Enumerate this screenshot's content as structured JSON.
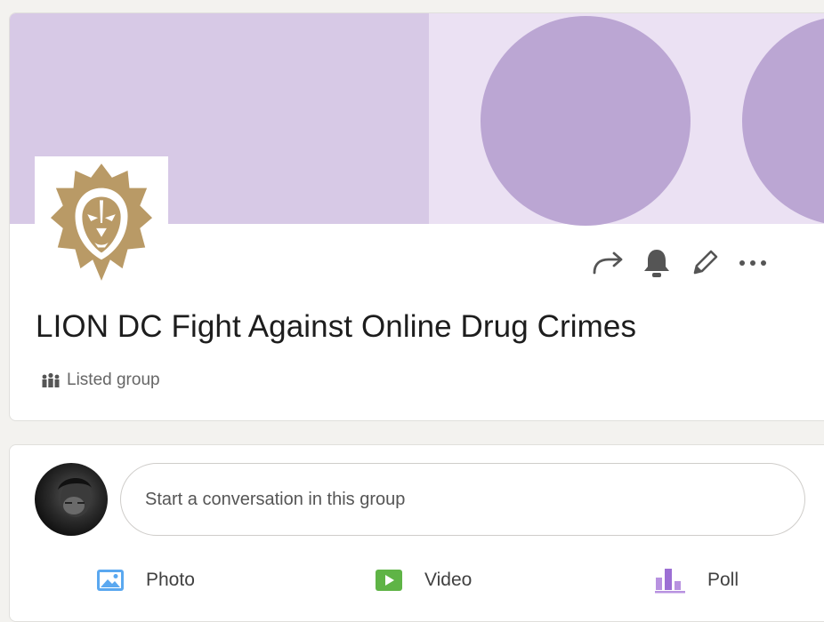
{
  "group": {
    "name": "LION DC Fight Against Online Drug Crimes",
    "visibility": "Listed group"
  },
  "actions": {
    "share": "share-icon",
    "notifications": "bell-icon",
    "edit": "pencil-icon",
    "more": "more-icon"
  },
  "composer": {
    "placeholder": "Start a conversation in this group",
    "photo_label": "Photo",
    "video_label": "Video",
    "poll_label": "Poll"
  },
  "colors": {
    "cover_left": "#d7c9e6",
    "cover_right": "#ebe1f3",
    "cover_circle": "#bba6d3",
    "photo_icon": "#5aa8f0",
    "video_icon": "#5fb446",
    "poll_icon": "#b892e0",
    "logo_gold": "#b99a66"
  }
}
